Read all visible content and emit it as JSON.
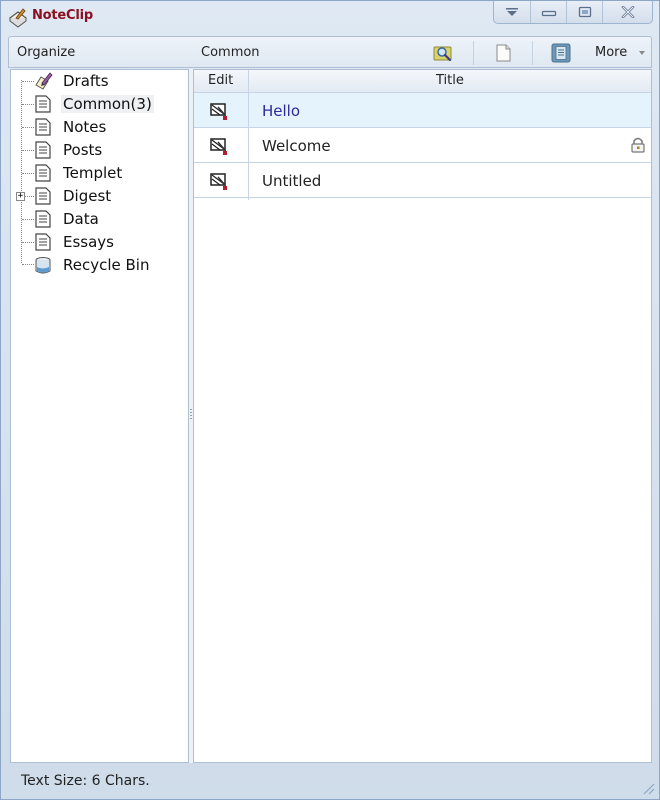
{
  "window": {
    "title": "NoteClip",
    "controls": [
      "menu-dropdown",
      "minimize",
      "restore",
      "close"
    ]
  },
  "toolbar": {
    "organize_label": "Organize",
    "current_folder_label": "Common",
    "icons": [
      "search-folder-icon",
      "new-note-icon",
      "view-icon"
    ],
    "more_label": "More"
  },
  "tree": {
    "items": [
      {
        "label": "Drafts",
        "icon": "pen-icon",
        "selected": false,
        "expandable": false
      },
      {
        "label": "Common(3)",
        "icon": "document-icon",
        "selected": true,
        "expandable": false
      },
      {
        "label": "Notes",
        "icon": "document-icon",
        "selected": false,
        "expandable": false
      },
      {
        "label": "Posts",
        "icon": "document-icon",
        "selected": false,
        "expandable": false
      },
      {
        "label": "Templet",
        "icon": "document-icon",
        "selected": false,
        "expandable": false
      },
      {
        "label": "Digest",
        "icon": "document-icon",
        "selected": false,
        "expandable": true
      },
      {
        "label": "Data",
        "icon": "document-icon",
        "selected": false,
        "expandable": false
      },
      {
        "label": "Essays",
        "icon": "document-icon",
        "selected": false,
        "expandable": false
      },
      {
        "label": "Recycle Bin",
        "icon": "recycle-bin-icon",
        "selected": false,
        "expandable": false
      }
    ],
    "expander_symbol": "+"
  },
  "table": {
    "columns": [
      "Edit",
      "Title"
    ],
    "rows": [
      {
        "title": "Hello",
        "selected": true,
        "locked": false
      },
      {
        "title": "Welcome",
        "selected": false,
        "locked": true
      },
      {
        "title": "Untitled",
        "selected": false,
        "locked": false
      }
    ]
  },
  "status": {
    "text": "Text Size: 6 Chars."
  },
  "colors": {
    "title_text": "#8a1020",
    "selected_row_bg": "#e5f3fc",
    "selected_row_text": "#2a2a9a",
    "chrome_bg": "#dbe5f1",
    "border": "#aebfd4"
  }
}
